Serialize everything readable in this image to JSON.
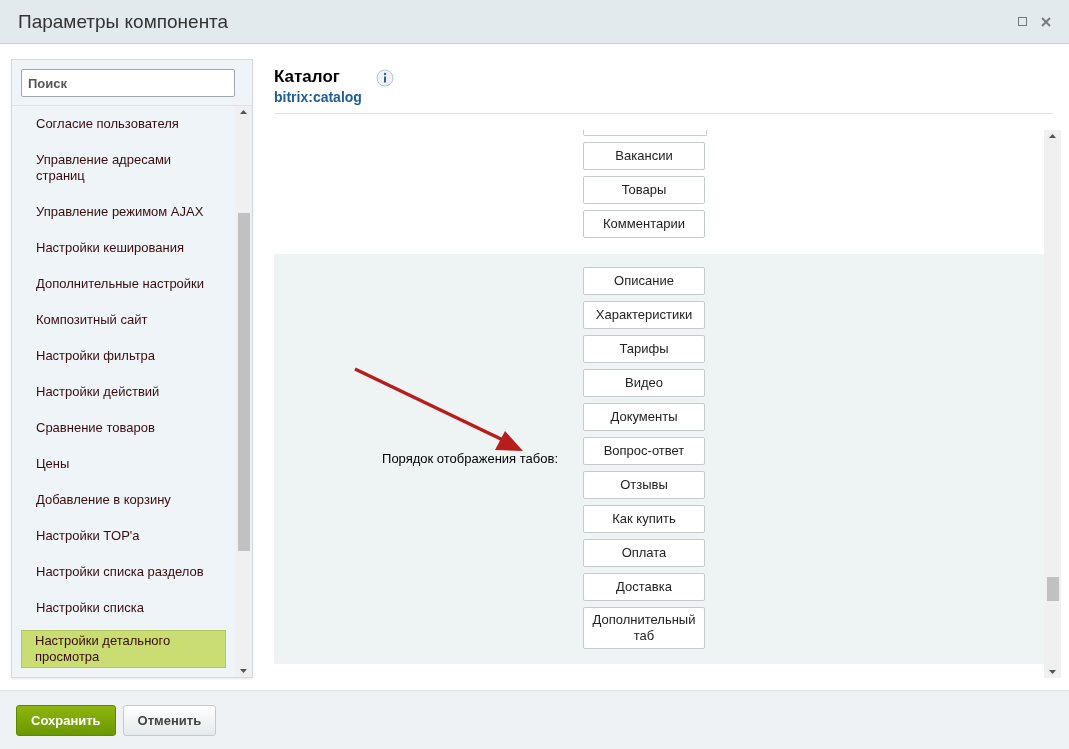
{
  "window": {
    "title": "Параметры компонента"
  },
  "sidebar": {
    "search": {
      "placeholder": "Поиск"
    },
    "items": [
      {
        "label": "Согласие пользователя",
        "selected": false
      },
      {
        "label": "Управление адресами страниц",
        "selected": false
      },
      {
        "label": "Управление режимом AJAX",
        "selected": false
      },
      {
        "label": "Настройки кеширования",
        "selected": false
      },
      {
        "label": "Дополнительные настройки",
        "selected": false
      },
      {
        "label": "Композитный сайт",
        "selected": false
      },
      {
        "label": "Настройки фильтра",
        "selected": false
      },
      {
        "label": "Настройки действий",
        "selected": false
      },
      {
        "label": "Сравнение товаров",
        "selected": false
      },
      {
        "label": "Цены",
        "selected": false
      },
      {
        "label": "Добавление в корзину",
        "selected": false
      },
      {
        "label": "Настройки TOP'а",
        "selected": false
      },
      {
        "label": "Настройки списка разделов",
        "selected": false
      },
      {
        "label": "Настройки списка",
        "selected": false
      },
      {
        "label": "Настройки детального просмотра",
        "selected": true
      }
    ]
  },
  "component": {
    "title": "Каталог",
    "code": "bitrix:catalog"
  },
  "sections": [
    {
      "buttons": [
        "Вакансии",
        "Товары",
        "Комментарии"
      ]
    },
    {
      "label": "Порядок отображения табов:",
      "buttons": [
        "Описание",
        "Характеристики",
        "Тарифы",
        "Видео",
        "Документы",
        "Вопрос-ответ",
        "Отзывы",
        "Как купить",
        "Оплата",
        "Доставка",
        "Дополнительный таб"
      ]
    }
  ],
  "footer": {
    "buttons": [
      {
        "label": "Сохранить",
        "kind": "primary"
      },
      {
        "label": "Отменить",
        "kind": "secondary"
      }
    ]
  }
}
